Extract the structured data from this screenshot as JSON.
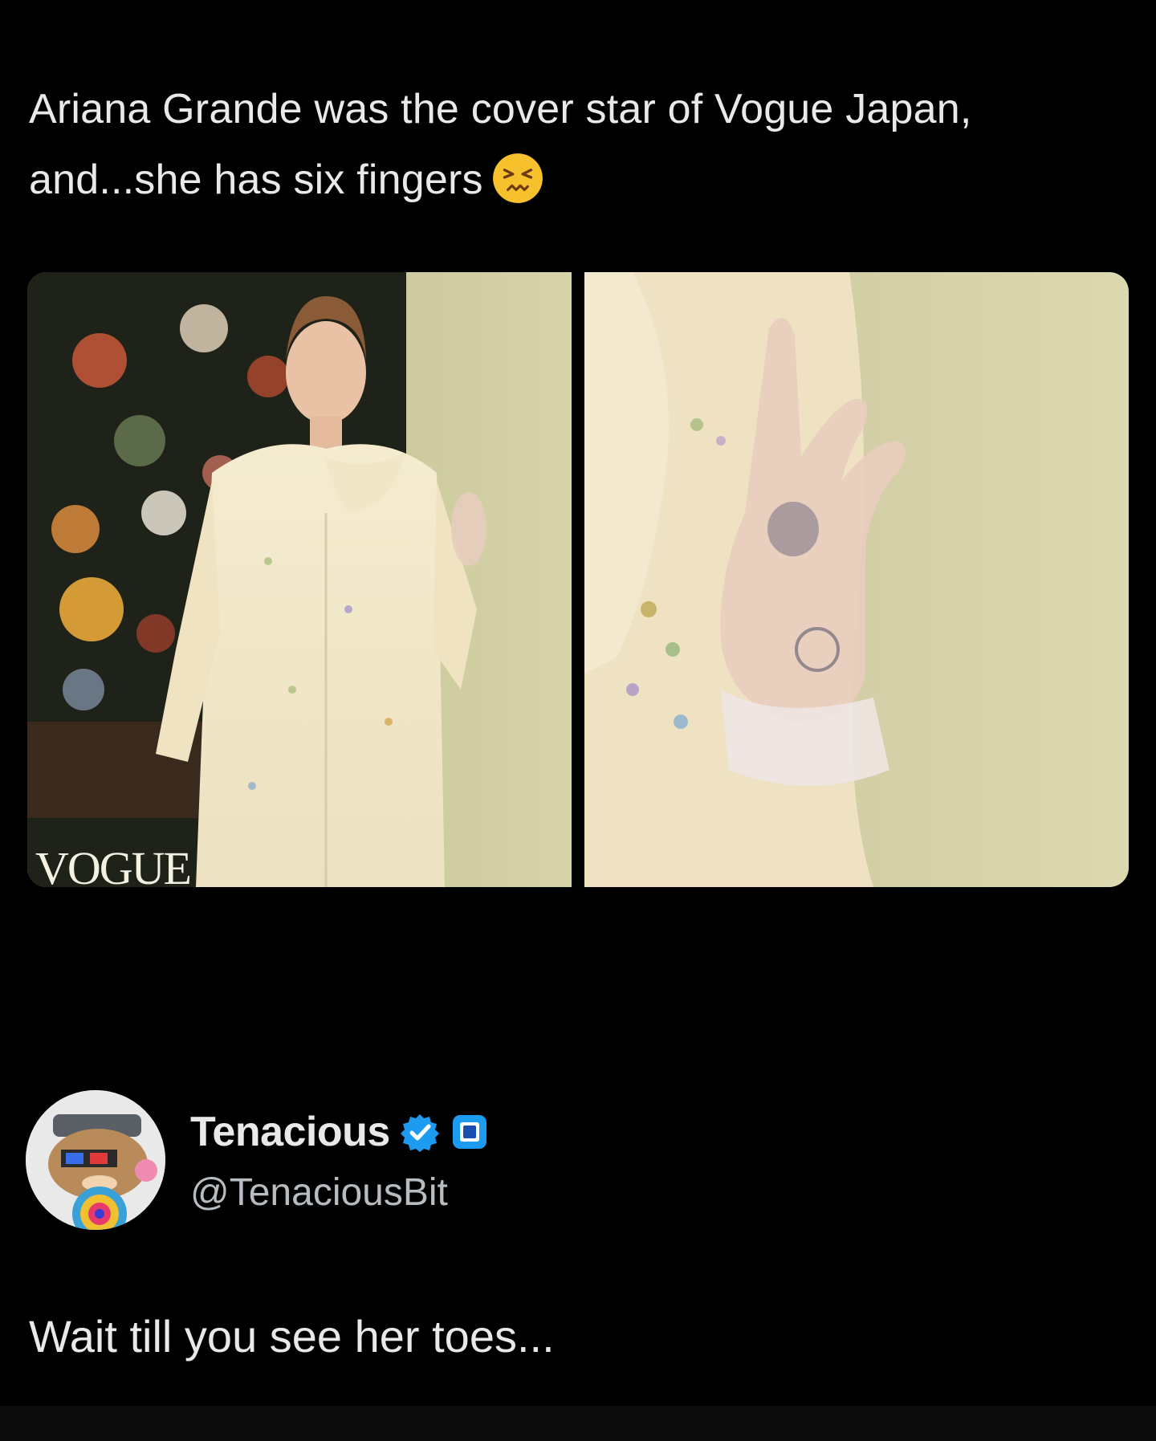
{
  "post": {
    "text_line1": "Ariana Grande was the cover star of Vogue Japan,",
    "text_line2": "and...she has six fingers",
    "emoji": "confounded-face-emoji"
  },
  "media": {
    "left_image": {
      "type": "magazine-cover-photo",
      "cover_logo": "VOGUE"
    },
    "right_image": {
      "type": "hand-closeup-photo"
    }
  },
  "reply": {
    "display_name": "Tenacious",
    "handle": "@TenaciousBit",
    "text": "Wait till you see her toes...",
    "verified_color": "#1d9bf0"
  },
  "colors": {
    "background": "#000000",
    "text": "#e7e9ea",
    "secondary_text": "#b7bcc1"
  }
}
